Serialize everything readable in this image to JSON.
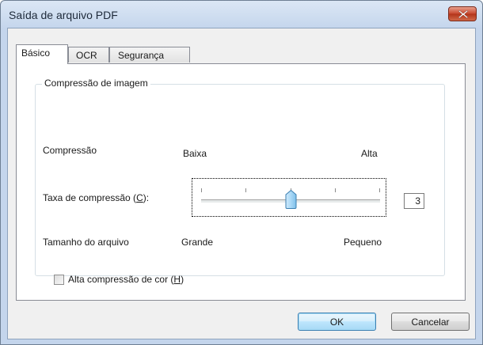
{
  "window": {
    "title": "Saída de arquivo PDF",
    "close_icon": "close-icon"
  },
  "tabs": [
    {
      "label": "Básico",
      "active": true
    },
    {
      "label": "OCR",
      "active": false
    },
    {
      "label": "Segurança",
      "active": false
    }
  ],
  "group": {
    "title": "Compressão de imagem",
    "compression_label": "Compressão",
    "low_label": "Baixa",
    "high_label": "Alta",
    "rate_label_pre": "Taxa de compressão (",
    "rate_label_key": "C",
    "rate_label_post": "):",
    "rate_value": "3",
    "slider": {
      "min": 1,
      "max": 5,
      "value": 3
    },
    "filesize_label": "Tamanho do arquivo",
    "large_label": "Grande",
    "small_label": "Pequeno",
    "high_color_pre": "Alta compressão de cor (",
    "high_color_key": "H",
    "high_color_post": ")",
    "high_color_checked": false
  },
  "buttons": {
    "ok": "OK",
    "cancel": "Cancelar"
  }
}
